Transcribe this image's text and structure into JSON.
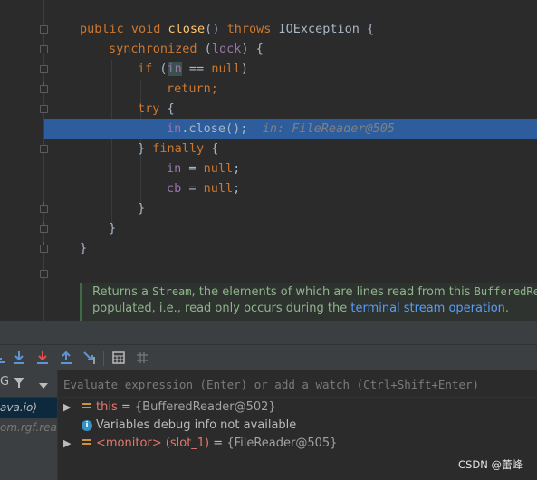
{
  "editor": {
    "code_lines": [
      {
        "kw1": "public void ",
        "fn": "close",
        "mid": "() ",
        "kw2": "throws ",
        "rest": "IOException {"
      },
      {
        "kw": "synchronized ",
        "rest1": "(",
        "fld": "lock",
        "rest2": ") {"
      },
      {
        "kw": "if ",
        "rest1": "(",
        "ivar": "in",
        "rest2": " == ",
        "kw2": "null",
        "rest3": ")"
      },
      {
        "kw": "return",
        "rest": ";"
      },
      {
        "kw": "try ",
        "rest": "{"
      },
      {
        "ivar": "in",
        "rest": ".close();",
        "inline": "in: FileReader@505"
      },
      {
        "rest": "} ",
        "kw": "finally ",
        "rest2": "{"
      },
      {
        "ivar": "in",
        "rest": " = ",
        "kw": "null",
        "rest2": ";"
      },
      {
        "ivar": "cb",
        "rest": " = ",
        "kw": "null",
        "rest2": ";"
      },
      {
        "rest": "}"
      },
      {
        "rest": "}"
      },
      {
        "rest": "}"
      }
    ],
    "doc": {
      "line1_a": "Returns a ",
      "line1_code": "Stream",
      "line1_b": ", the elements of which are lines read from this ",
      "line1_code2": "BufferedReader",
      "line2_a": "populated, i.e., read only occurs during the ",
      "line2_link": "terminal stream operation",
      "line2_b": "."
    }
  },
  "debug": {
    "toolbar_icons": [
      "step-over-icon",
      "step-into-icon",
      "force-step-into-icon",
      "step-out-icon",
      "run-to-cursor-icon",
      "evaluate-expression-icon",
      "trace-icon"
    ],
    "frames_header": "G",
    "frames": [
      {
        "label": "ava.io)",
        "selected": true
      },
      {
        "label": "om.rgf.read",
        "selected": false
      }
    ],
    "watch_placeholder": "Evaluate expression (Enter) or add a watch (Ctrl+Shift+Enter)",
    "variables": [
      {
        "name": "this",
        "eq": " = ",
        "value": "{BufferedReader@502}",
        "expandable": true,
        "icon": "field-icon"
      },
      {
        "text": "Variables debug info not available",
        "icon": "info-icon"
      },
      {
        "name": "<monitor> (slot_1)",
        "eq": " = ",
        "value": "{FileReader@505}",
        "expandable": true,
        "icon": "field-icon"
      }
    ]
  },
  "watermark": "CSDN @蕾峰"
}
